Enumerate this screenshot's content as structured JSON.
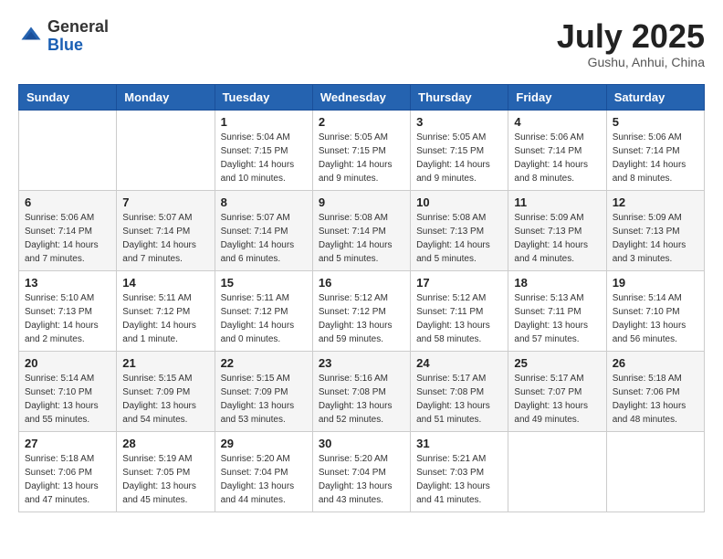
{
  "header": {
    "logo_line1": "General",
    "logo_line2": "Blue",
    "month": "July 2025",
    "location": "Gushu, Anhui, China"
  },
  "weekdays": [
    "Sunday",
    "Monday",
    "Tuesday",
    "Wednesday",
    "Thursday",
    "Friday",
    "Saturday"
  ],
  "weeks": [
    [
      {
        "day": "",
        "info": ""
      },
      {
        "day": "",
        "info": ""
      },
      {
        "day": "1",
        "info": "Sunrise: 5:04 AM\nSunset: 7:15 PM\nDaylight: 14 hours\nand 10 minutes."
      },
      {
        "day": "2",
        "info": "Sunrise: 5:05 AM\nSunset: 7:15 PM\nDaylight: 14 hours\nand 9 minutes."
      },
      {
        "day": "3",
        "info": "Sunrise: 5:05 AM\nSunset: 7:15 PM\nDaylight: 14 hours\nand 9 minutes."
      },
      {
        "day": "4",
        "info": "Sunrise: 5:06 AM\nSunset: 7:14 PM\nDaylight: 14 hours\nand 8 minutes."
      },
      {
        "day": "5",
        "info": "Sunrise: 5:06 AM\nSunset: 7:14 PM\nDaylight: 14 hours\nand 8 minutes."
      }
    ],
    [
      {
        "day": "6",
        "info": "Sunrise: 5:06 AM\nSunset: 7:14 PM\nDaylight: 14 hours\nand 7 minutes."
      },
      {
        "day": "7",
        "info": "Sunrise: 5:07 AM\nSunset: 7:14 PM\nDaylight: 14 hours\nand 7 minutes."
      },
      {
        "day": "8",
        "info": "Sunrise: 5:07 AM\nSunset: 7:14 PM\nDaylight: 14 hours\nand 6 minutes."
      },
      {
        "day": "9",
        "info": "Sunrise: 5:08 AM\nSunset: 7:14 PM\nDaylight: 14 hours\nand 5 minutes."
      },
      {
        "day": "10",
        "info": "Sunrise: 5:08 AM\nSunset: 7:13 PM\nDaylight: 14 hours\nand 5 minutes."
      },
      {
        "day": "11",
        "info": "Sunrise: 5:09 AM\nSunset: 7:13 PM\nDaylight: 14 hours\nand 4 minutes."
      },
      {
        "day": "12",
        "info": "Sunrise: 5:09 AM\nSunset: 7:13 PM\nDaylight: 14 hours\nand 3 minutes."
      }
    ],
    [
      {
        "day": "13",
        "info": "Sunrise: 5:10 AM\nSunset: 7:13 PM\nDaylight: 14 hours\nand 2 minutes."
      },
      {
        "day": "14",
        "info": "Sunrise: 5:11 AM\nSunset: 7:12 PM\nDaylight: 14 hours\nand 1 minute."
      },
      {
        "day": "15",
        "info": "Sunrise: 5:11 AM\nSunset: 7:12 PM\nDaylight: 14 hours\nand 0 minutes."
      },
      {
        "day": "16",
        "info": "Sunrise: 5:12 AM\nSunset: 7:12 PM\nDaylight: 13 hours\nand 59 minutes."
      },
      {
        "day": "17",
        "info": "Sunrise: 5:12 AM\nSunset: 7:11 PM\nDaylight: 13 hours\nand 58 minutes."
      },
      {
        "day": "18",
        "info": "Sunrise: 5:13 AM\nSunset: 7:11 PM\nDaylight: 13 hours\nand 57 minutes."
      },
      {
        "day": "19",
        "info": "Sunrise: 5:14 AM\nSunset: 7:10 PM\nDaylight: 13 hours\nand 56 minutes."
      }
    ],
    [
      {
        "day": "20",
        "info": "Sunrise: 5:14 AM\nSunset: 7:10 PM\nDaylight: 13 hours\nand 55 minutes."
      },
      {
        "day": "21",
        "info": "Sunrise: 5:15 AM\nSunset: 7:09 PM\nDaylight: 13 hours\nand 54 minutes."
      },
      {
        "day": "22",
        "info": "Sunrise: 5:15 AM\nSunset: 7:09 PM\nDaylight: 13 hours\nand 53 minutes."
      },
      {
        "day": "23",
        "info": "Sunrise: 5:16 AM\nSunset: 7:08 PM\nDaylight: 13 hours\nand 52 minutes."
      },
      {
        "day": "24",
        "info": "Sunrise: 5:17 AM\nSunset: 7:08 PM\nDaylight: 13 hours\nand 51 minutes."
      },
      {
        "day": "25",
        "info": "Sunrise: 5:17 AM\nSunset: 7:07 PM\nDaylight: 13 hours\nand 49 minutes."
      },
      {
        "day": "26",
        "info": "Sunrise: 5:18 AM\nSunset: 7:06 PM\nDaylight: 13 hours\nand 48 minutes."
      }
    ],
    [
      {
        "day": "27",
        "info": "Sunrise: 5:18 AM\nSunset: 7:06 PM\nDaylight: 13 hours\nand 47 minutes."
      },
      {
        "day": "28",
        "info": "Sunrise: 5:19 AM\nSunset: 7:05 PM\nDaylight: 13 hours\nand 45 minutes."
      },
      {
        "day": "29",
        "info": "Sunrise: 5:20 AM\nSunset: 7:04 PM\nDaylight: 13 hours\nand 44 minutes."
      },
      {
        "day": "30",
        "info": "Sunrise: 5:20 AM\nSunset: 7:04 PM\nDaylight: 13 hours\nand 43 minutes."
      },
      {
        "day": "31",
        "info": "Sunrise: 5:21 AM\nSunset: 7:03 PM\nDaylight: 13 hours\nand 41 minutes."
      },
      {
        "day": "",
        "info": ""
      },
      {
        "day": "",
        "info": ""
      }
    ]
  ]
}
